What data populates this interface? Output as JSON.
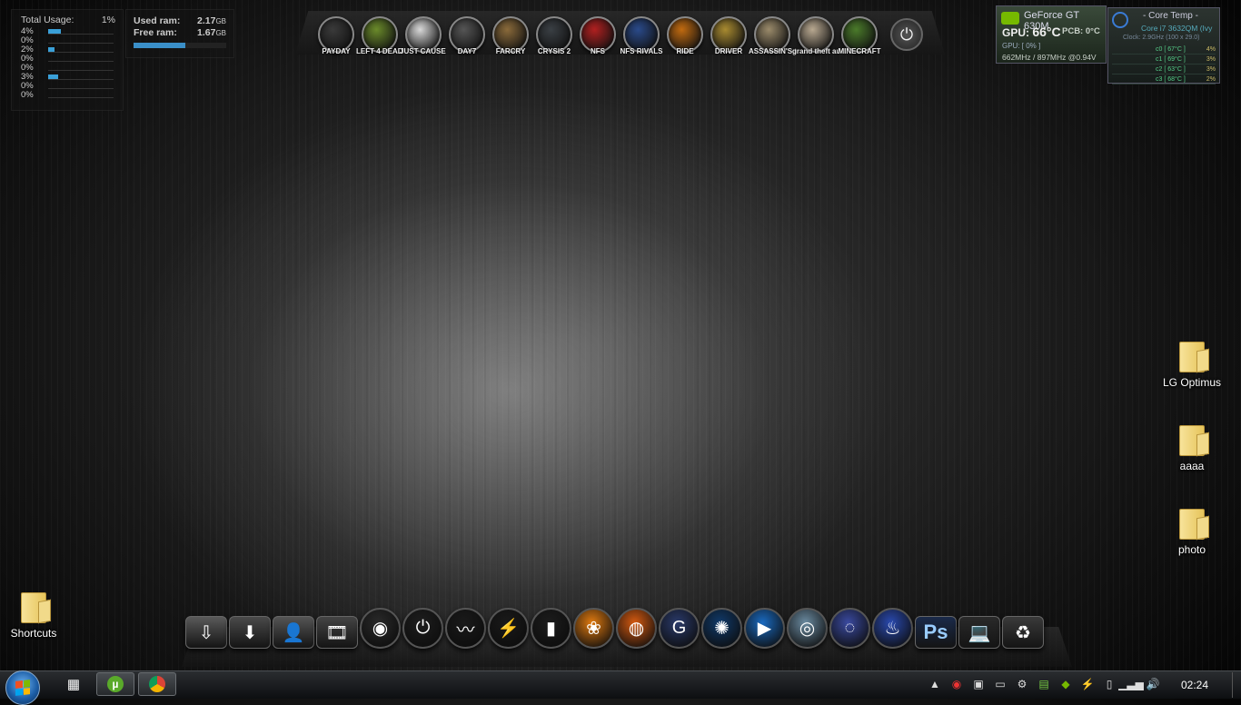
{
  "cpu": {
    "label": "Total Usage:",
    "total": "1%",
    "cores": [
      {
        "value": "4%",
        "fill": 0.04
      },
      {
        "value": "0%",
        "fill": 0.0
      },
      {
        "value": "2%",
        "fill": 0.02
      },
      {
        "value": "0%",
        "fill": 0.0
      },
      {
        "value": "0%",
        "fill": 0.0
      },
      {
        "value": "3%",
        "fill": 0.03
      },
      {
        "value": "0%",
        "fill": 0.0
      },
      {
        "value": "0%",
        "fill": 0.0
      }
    ]
  },
  "ram": {
    "used_label": "Used ram:",
    "used_value": "2.17",
    "free_label": "Free ram:",
    "free_value": "1.67",
    "unit": "GB",
    "used_fraction": 0.56
  },
  "games": [
    {
      "name": "PAYDAY",
      "color": "#3a3a3a"
    },
    {
      "name": "LEFT 4 DEAD 2",
      "color": "#6a8a2a"
    },
    {
      "name": "JUST CAUSE 2",
      "color": "#d8d8d8"
    },
    {
      "name": "DAY7",
      "color": "#555555"
    },
    {
      "name": "FARCRY",
      "color": "#8a6a3a"
    },
    {
      "name": "CRYSIS 2",
      "color": "#3a3f44"
    },
    {
      "name": "NFS",
      "color": "#b02020"
    },
    {
      "name": "NFS RIVALS",
      "color": "#2a4a8a"
    },
    {
      "name": "RIDE",
      "color": "#c06a10"
    },
    {
      "name": "DRIVER",
      "color": "#a88a30"
    },
    {
      "name": "ASSASSIN'S CREED",
      "color": "#9a8a6a"
    },
    {
      "name": "grand theft auto",
      "color": "#b8a890"
    },
    {
      "name": "MINECRAFT",
      "color": "#4a7a2a"
    }
  ],
  "gpu": {
    "title": "GeForce GT 630M",
    "temp_label": "GPU:",
    "temp": "66°C",
    "pcb": "PCB: 0°C",
    "load": "GPU: [ 0% ]",
    "clocks": "662MHz / 897MHz @0.94V"
  },
  "coretemp": {
    "title": "- Core Temp -",
    "cpu": "Core i7 3632QM (Ivy",
    "clock": "Clock: 2.9GHz (100 x 29.0)",
    "cores": [
      {
        "name": "c0",
        "temp": "[ 67°C ]",
        "load": "4%"
      },
      {
        "name": "c1",
        "temp": "[ 69°C ]",
        "load": "3%"
      },
      {
        "name": "c2",
        "temp": "[ 63°C ]",
        "load": "3%"
      },
      {
        "name": "c3",
        "temp": "[ 68°C ]",
        "load": "2%"
      }
    ]
  },
  "desktop_icons": {
    "lg": "LG Optimus",
    "aaaa": "aaaa",
    "photo": "photo",
    "shortcuts": "Shortcuts"
  },
  "dock_items": [
    {
      "name": "documents-dock-item",
      "glyph": "⇩",
      "color": "#5a5a5a",
      "shape": "sq"
    },
    {
      "name": "downloads-dock-item",
      "glyph": "⬇",
      "color": "#4a4a4a",
      "shape": "sq"
    },
    {
      "name": "user-dock-item",
      "glyph": "👤",
      "color": "#555555",
      "shape": "sq"
    },
    {
      "name": "videos-dock-item",
      "glyph": "🎞",
      "color": "#444444",
      "shape": "sq"
    },
    {
      "name": "dvd-dock-item",
      "glyph": "◉",
      "color": "#2a2a2a",
      "shape": "round"
    },
    {
      "name": "power-dock-item",
      "glyph": "⏻",
      "color": "#1e1e1e",
      "shape": "round"
    },
    {
      "name": "pulse-dock-item",
      "glyph": "〰",
      "color": "#1a1a1a",
      "shape": "round"
    },
    {
      "name": "winamp-dock-item",
      "glyph": "⚡",
      "color": "#1a1a1a",
      "shape": "round"
    },
    {
      "name": "equalizer-dock-item",
      "glyph": "▮",
      "color": "#1c1c1c",
      "shape": "round"
    },
    {
      "name": "fl-studio-dock-item",
      "glyph": "❀",
      "color": "#e07a10",
      "shape": "round"
    },
    {
      "name": "firefox-dock-item",
      "glyph": "◍",
      "color": "#d55a10",
      "shape": "round"
    },
    {
      "name": "google-dock-item",
      "glyph": "G",
      "color": "#2a3a6a",
      "shape": "round"
    },
    {
      "name": "network-dock-item",
      "glyph": "✺",
      "color": "#103a6a",
      "shape": "round"
    },
    {
      "name": "media-player-dock-item",
      "glyph": "▶",
      "color": "#1a6ac0",
      "shape": "round"
    },
    {
      "name": "chrome-dock-item",
      "glyph": "◎",
      "color": "#6a8aa0",
      "shape": "round"
    },
    {
      "name": "opera-dock-item",
      "glyph": "◌",
      "color": "#3a4aa0",
      "shape": "round"
    },
    {
      "name": "flame-dock-item",
      "glyph": "♨",
      "color": "#2a4ab0",
      "shape": "round"
    },
    {
      "name": "photoshop-dock-item",
      "glyph": "Ps",
      "color": "#1a2a4a",
      "shape": "sq"
    },
    {
      "name": "laptop-dock-item",
      "glyph": "💻",
      "color": "#2a2a2a",
      "shape": "sq"
    },
    {
      "name": "recycle-bin-dock-item",
      "glyph": "♻",
      "color": "#3a3a3a",
      "shape": "sq"
    }
  ],
  "taskbar": {
    "clock": "02:24"
  }
}
